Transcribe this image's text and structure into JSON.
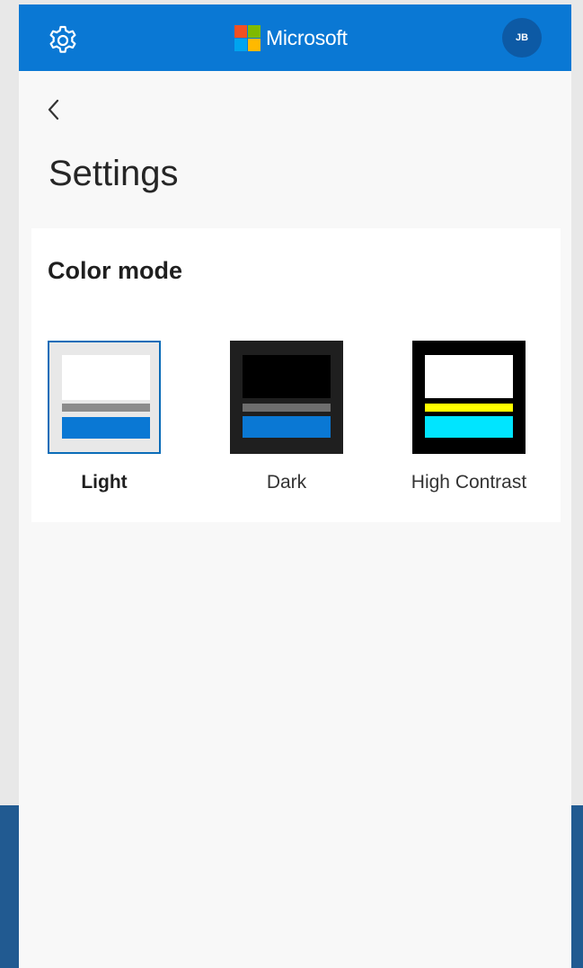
{
  "header": {
    "brand": "Microsoft",
    "avatar_initials": "JB",
    "settings_icon": "gear-icon",
    "brand_color": "#0a78d4",
    "logo_colors": [
      "#f25022",
      "#7fba00",
      "#00a4ef",
      "#ffb900"
    ]
  },
  "navigation": {
    "back_icon": "chevron-left-icon"
  },
  "page": {
    "title": "Settings"
  },
  "color_mode": {
    "title": "Color mode",
    "selected": "Light",
    "options": [
      {
        "label": "Light",
        "selected": true,
        "colors": {
          "frame": "#e8e8e8",
          "top": "#ffffff",
          "line": "#8c8c8c",
          "accent": "#0a78d4",
          "border": "#0a6cb8"
        }
      },
      {
        "label": "Dark",
        "selected": false,
        "colors": {
          "frame": "#1f1f1f",
          "top": "#000000",
          "line": "#6e6e6e",
          "accent": "#0a78d4"
        }
      },
      {
        "label": "High Contrast",
        "selected": false,
        "colors": {
          "frame": "#000000",
          "top": "#ffffff",
          "line": "#ffff00",
          "accent": "#00e5ff"
        }
      }
    ]
  }
}
